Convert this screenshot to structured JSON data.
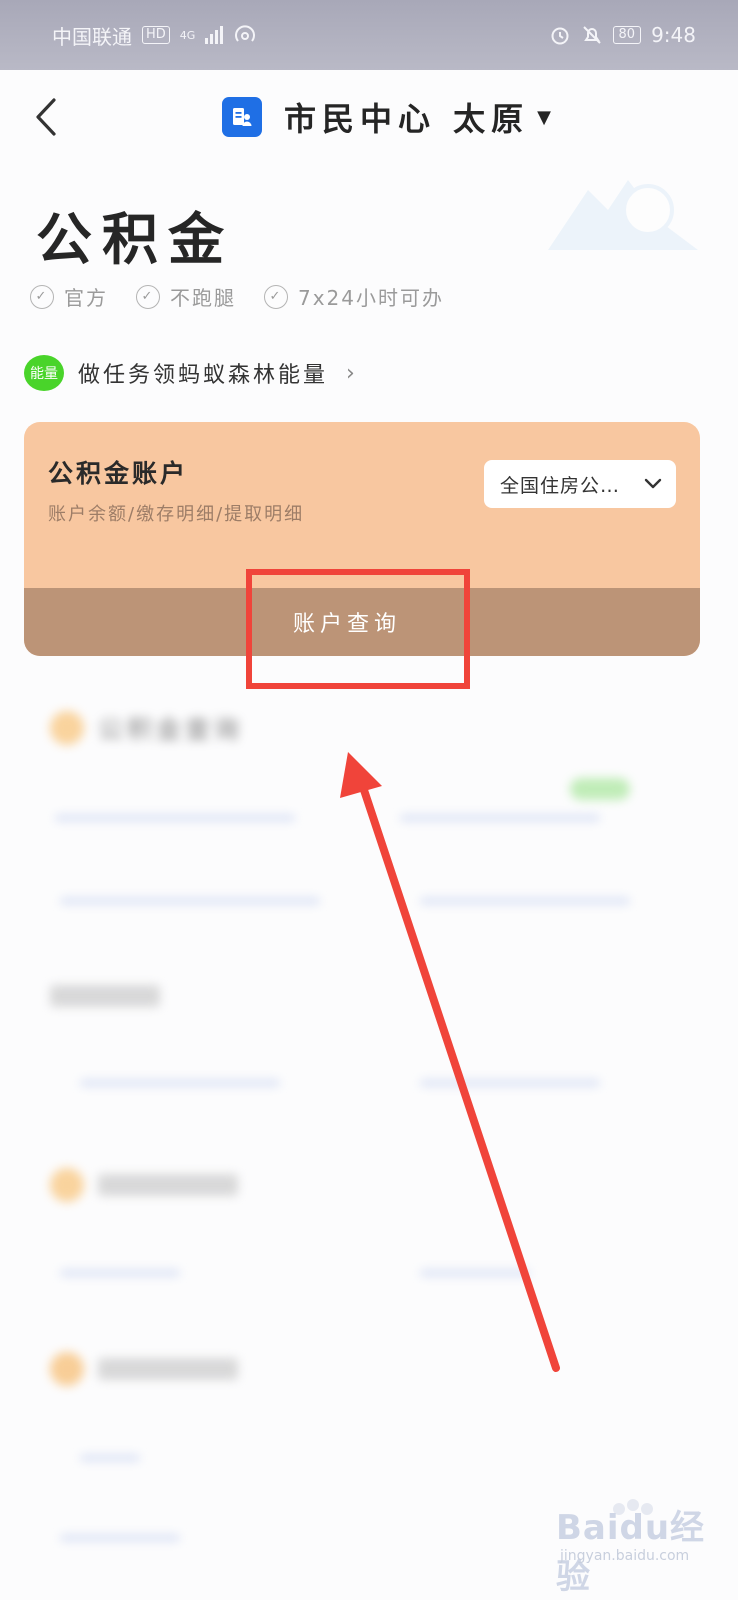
{
  "status_bar": {
    "carrier": "中国联通",
    "hd_badge": "HD",
    "network": "4G",
    "battery": "80",
    "time": "9:48"
  },
  "nav": {
    "title": "市民中心 太原",
    "back_icon": "chevron-left-icon",
    "logo_icon": "citizen-center-icon"
  },
  "page": {
    "title": "公积金",
    "features": [
      "官方",
      "不跑腿",
      "7x24小时可办"
    ]
  },
  "energy": {
    "badge": "能量",
    "text": "做任务领蚂蚁森林能量"
  },
  "card": {
    "title": "公积金账户",
    "subtitle": "账户余额/缴存明细/提取明细",
    "select_value": "全国住房公…",
    "action_label": "账户查询",
    "bg_color": "#f8c7a0",
    "action_bg_color": "#bc9477"
  },
  "blurred_section": {
    "title": "公积金查询"
  },
  "watermark": {
    "text": "Baidu经验",
    "sub": "jingyan.baidu.com"
  },
  "annotation_color": "#f0443a"
}
